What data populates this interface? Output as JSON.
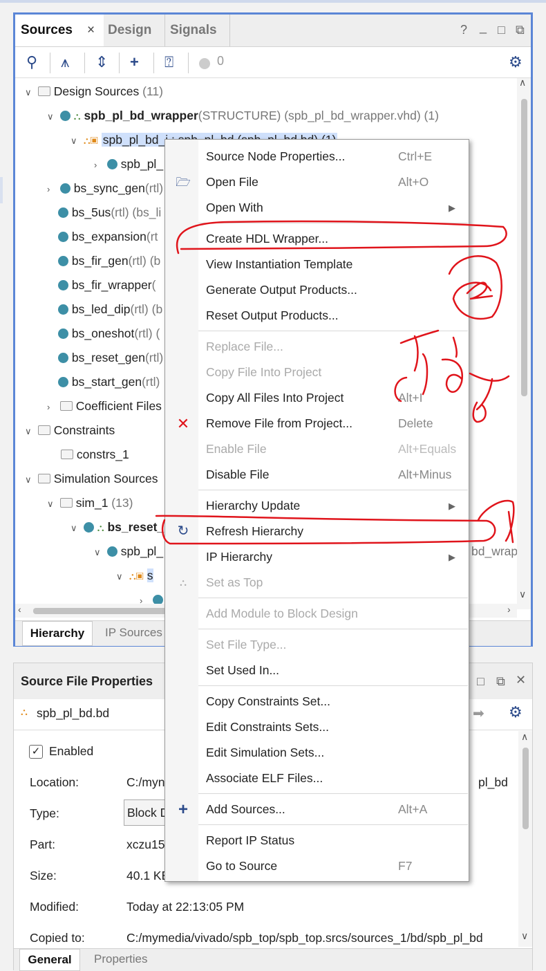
{
  "sources": {
    "tabs": [
      "Sources",
      "Design",
      "Signals"
    ],
    "tab_close": "×",
    "win_icons": [
      "?",
      "_",
      "□",
      "⧉"
    ],
    "toolbar_count": "0",
    "tree": [
      {
        "label": "Design Sources",
        "suffix": " (11)"
      },
      {
        "label": "spb_pl_bd_wrapper",
        "suffix": "(STRUCTURE) (spb_pl_bd_wrapper.vhd) (1)"
      },
      {
        "label": "spb_pl_bd_i : spb_pl_bd (spb_pl_bd.bd) (1)",
        "suffix": ""
      },
      {
        "label": "spb_pl_",
        "suffix": ""
      },
      {
        "label": "bs_sync_gen",
        "suffix": "(rtl)"
      },
      {
        "label": "bs_5us",
        "suffix": "(rtl) (bs_li"
      },
      {
        "label": "bs_expansion",
        "suffix": "(rt"
      },
      {
        "label": "bs_fir_gen",
        "suffix": "(rtl) (b"
      },
      {
        "label": "bs_fir_wrapper",
        "suffix": "("
      },
      {
        "label": "bs_led_dip",
        "suffix": "(rtl) (b"
      },
      {
        "label": "bs_oneshot",
        "suffix": "(rtl) ("
      },
      {
        "label": "bs_reset_gen",
        "suffix": "(rtl)"
      },
      {
        "label": "bs_start_gen",
        "suffix": "(rtl)"
      },
      {
        "label": "Coefficient Files",
        "suffix": ""
      },
      {
        "label": "Constraints",
        "suffix": ""
      },
      {
        "label": "constrs_1",
        "suffix": ""
      },
      {
        "label": "Simulation Sources",
        "suffix": ""
      },
      {
        "label": "sim_1",
        "suffix": " (13)"
      },
      {
        "label": "bs_reset_",
        "suffix": ""
      },
      {
        "label": "spb_pl_",
        "suffix": ""
      },
      {
        "label": "s",
        "suffix": ""
      }
    ],
    "right_peek": "bd_wrap",
    "bottom_tabs": [
      "Hierarchy",
      "IP Sources"
    ]
  },
  "properties": {
    "title": "Source File Properties",
    "file": "spb_pl_bd.bd",
    "enabled_label": "Enabled",
    "rows": [
      {
        "label": "Location:",
        "value": "C:/myn",
        "right": "pl_bd"
      },
      {
        "label": "Type:",
        "value": "Block D",
        "right": ""
      },
      {
        "label": "Part:",
        "value": "xczu15",
        "right": ""
      },
      {
        "label": "Size:",
        "value": "40.1 KE",
        "right": ""
      },
      {
        "label": "Modified:",
        "value": "Today at 22:13:05 PM",
        "right": ""
      },
      {
        "label": "Copied to:",
        "value": "C:/mymedia/vivado/spb_top/spb_top.srcs/sources_1/bd/spb_pl_bd",
        "right": ""
      }
    ],
    "bottom_tabs": [
      "General",
      "Properties"
    ]
  },
  "menu": {
    "items": [
      {
        "label": "Source Node Properties...",
        "shortcut": "Ctrl+E"
      },
      {
        "label": "Open File",
        "shortcut": "Alt+O"
      },
      {
        "label": "Open With",
        "shortcut": ""
      },
      {
        "label": "Create HDL Wrapper...",
        "shortcut": ""
      },
      {
        "label": "View Instantiation Template",
        "shortcut": ""
      },
      {
        "label": "Generate Output Products...",
        "shortcut": ""
      },
      {
        "label": "Reset Output Products...",
        "shortcut": ""
      },
      {
        "label": "Replace File...",
        "shortcut": ""
      },
      {
        "label": "Copy File Into Project",
        "shortcut": ""
      },
      {
        "label": "Copy All Files Into Project",
        "shortcut": "Alt+I"
      },
      {
        "label": "Remove File from Project...",
        "shortcut": "Delete"
      },
      {
        "label": "Enable File",
        "shortcut": "Alt+Equals"
      },
      {
        "label": "Disable File",
        "shortcut": "Alt+Minus"
      },
      {
        "label": "Hierarchy Update",
        "shortcut": ""
      },
      {
        "label": "Refresh Hierarchy",
        "shortcut": ""
      },
      {
        "label": "IP Hierarchy",
        "shortcut": ""
      },
      {
        "label": "Set as Top",
        "shortcut": ""
      },
      {
        "label": "Add Module to Block Design",
        "shortcut": ""
      },
      {
        "label": "Set File Type...",
        "shortcut": ""
      },
      {
        "label": "Set Used In...",
        "shortcut": ""
      },
      {
        "label": "Copy Constraints Set...",
        "shortcut": ""
      },
      {
        "label": "Edit Constraints Sets...",
        "shortcut": ""
      },
      {
        "label": "Edit Simulation Sets...",
        "shortcut": ""
      },
      {
        "label": "Associate ELF Files...",
        "shortcut": ""
      },
      {
        "label": "Add Sources...",
        "shortcut": "Alt+A"
      },
      {
        "label": "Report IP Status",
        "shortcut": ""
      },
      {
        "label": "Go to Source",
        "shortcut": "F7"
      }
    ]
  },
  "colors": {
    "annotation": "#e0141b",
    "panel_border": "#5b86d6",
    "accent": "#2b4a8a"
  }
}
